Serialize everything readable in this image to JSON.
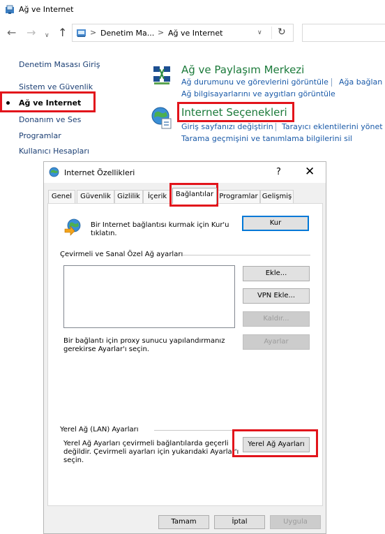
{
  "window": {
    "title": "Ağ ve Internet"
  },
  "address_bar": {
    "crumbs": [
      "Denetim Ma...",
      "Ağ ve Internet"
    ],
    "separator": ">"
  },
  "left_nav": {
    "items": [
      {
        "label": "Denetim Masası Giriş"
      },
      {
        "label": "Sistem ve Güvenlik"
      },
      {
        "label": "Ağ ve Internet"
      },
      {
        "label": "Donanım ve Ses"
      },
      {
        "label": "Programlar"
      },
      {
        "label": "Kullanıcı Hesapları"
      }
    ]
  },
  "categories": {
    "network_center": {
      "title": "Ağ ve Paylaşım Merkezi",
      "links": [
        "Ağ durumunu ve görevlerini görüntüle",
        "Ağa bağlan",
        "Ağ bilgisayarlarını ve aygıtları görüntüle"
      ]
    },
    "internet_options": {
      "title": "Internet Seçenekleri",
      "links": [
        "Giriş sayfanızı değiştirin",
        "Tarayıcı eklentilerini yönet",
        "Tarama geçmişini ve tanımlama bilgilerini sil"
      ]
    }
  },
  "dialog": {
    "title": "Internet Özellikleri",
    "help": "?",
    "close": "✕",
    "tabs": [
      "Genel",
      "Güvenlik",
      "Gizlilik",
      "İçerik",
      "Bağlantılar",
      "Programlar",
      "Gelişmiş"
    ],
    "setup_text": [
      "Bir Internet bağlantısı kurmak için Kur'u",
      "tıklatın."
    ],
    "setup_button": "Kur",
    "dialup_group_label": "Çevirmeli ve Sanal Özel Ağ ayarları",
    "add_button": "Ekle...",
    "add_vpn_button": "VPN Ekle...",
    "remove_button": "Kaldır...",
    "settings_button": "Ayarlar",
    "proxy_text": [
      "Bir bağlantı için proxy sunucu yapılandırmanız",
      "gerekirse Ayarlar'ı seçin."
    ],
    "lan_group_label": "Yerel Ağ (LAN) Ayarları",
    "lan_text": [
      "Yerel Ağ Ayarları çevirmeli bağlantılarda geçerli",
      "değildir. Çevirmeli ayarları için yukarıdaki Ayarlar'ı",
      "seçin."
    ],
    "lan_button": "Yerel Ağ Ayarları",
    "ok_button": "Tamam",
    "cancel_button": "İptal",
    "apply_button": "Uygula"
  },
  "colors": {
    "highlight": "#e2141b",
    "link": "#1a5aa8",
    "category_title": "#1b7a3a"
  }
}
